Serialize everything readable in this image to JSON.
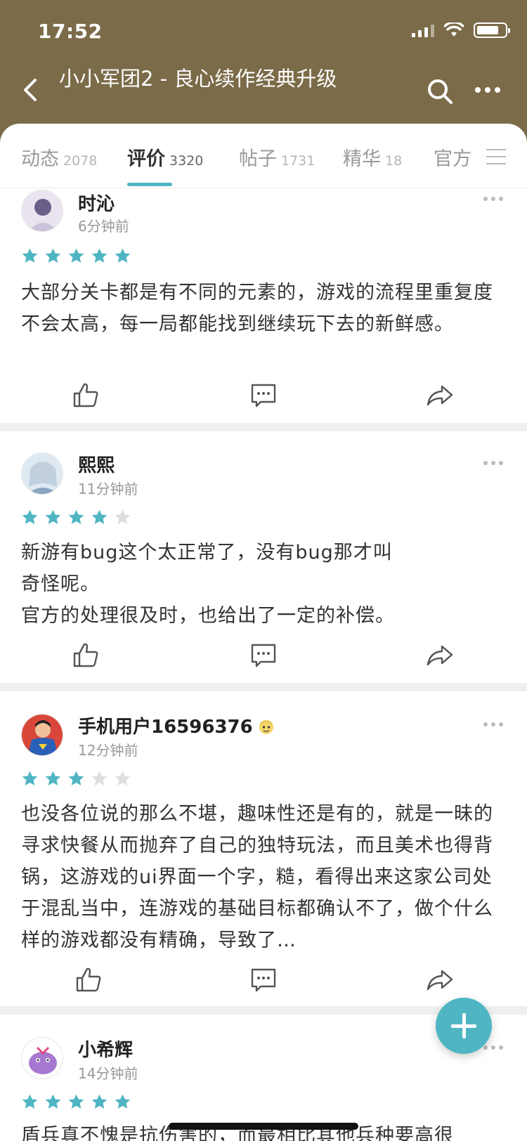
{
  "status_bar": {
    "time": "17:52"
  },
  "header": {
    "title": "小小军团2 - 良心续作经典升级"
  },
  "tabs": [
    {
      "label": "动态",
      "count": "2078"
    },
    {
      "label": "评价",
      "count": "3320"
    },
    {
      "label": "帖子",
      "count": "1731"
    },
    {
      "label": "精华",
      "count": "18"
    },
    {
      "label": "官方",
      "count": ""
    }
  ],
  "reviews": [
    {
      "username": "时沁",
      "time": "6分钟前",
      "rating": 5,
      "text": "大部分关卡都是有不同的元素的，游戏的流程里重复度不会太高，每一局都能找到继续玩下去的新鲜感。"
    },
    {
      "username": "熙熙",
      "time": "11分钟前",
      "rating": 4,
      "text_line1": "新游有bug这个太正常了，没有bug那才叫",
      "text_line2": "奇怪呢。",
      "text_line3": "官方的处理很及时，也给出了一定的补偿。"
    },
    {
      "username": "手机用户16596376",
      "time": "12分钟前",
      "rating": 3,
      "text": "也没各位说的那么不堪，趣味性还是有的，就是一昧的寻求快餐从而抛弃了自己的独特玩法，而且美术也得背锅，这游戏的ui界面一个字，糙，看得出来这家公司处于混乱当中，连游戏的基础目标都确认不了，做个什么样的游戏都没有精确，导致了…"
    },
    {
      "username": "小希辉",
      "time": "14分钟前",
      "rating": 5,
      "text": "盾兵真不愧是抗伤害的，而最相比其他兵种要高很"
    }
  ],
  "colors": {
    "header_bg": "#7b6b48",
    "accent": "#4fb5c3",
    "star_empty": "#dedede"
  },
  "icons": [
    "back-icon",
    "search-icon",
    "more-icon",
    "menu-icon",
    "like-icon",
    "comment-icon",
    "share-icon",
    "add-icon"
  ]
}
